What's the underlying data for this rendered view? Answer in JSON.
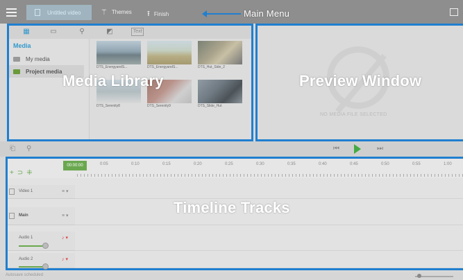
{
  "menubar": {
    "project_title": "Untitled video",
    "themes_label": "Themes",
    "finish_label": "Finish",
    "annotation": "Main Menu"
  },
  "media_library": {
    "tab_text": "Text",
    "section_title": "Media",
    "items": [
      {
        "label": "My media"
      },
      {
        "label": "Project media"
      }
    ],
    "thumbnails": [
      {
        "label": "DTS_EnergyandS..."
      },
      {
        "label": "DTS_EnergyandS..."
      },
      {
        "label": "DTS_Hut_Side_2"
      },
      {
        "label": "DTS_Serenity8"
      },
      {
        "label": "DTS_Serenity9"
      },
      {
        "label": "DTS_Slide_Hut"
      }
    ],
    "annotation": "Media Library"
  },
  "preview": {
    "message": "NO MEDIA FILE SELECTED",
    "annotation": "Preview Window"
  },
  "timeline": {
    "playhead": "00:00:00",
    "ticks": [
      "0:05",
      "0:10",
      "0:15",
      "0:20",
      "0:25",
      "0:30",
      "0:35",
      "0:40",
      "0:45",
      "0:50",
      "0:55",
      "1:00"
    ],
    "tracks": [
      {
        "name": "Video 1"
      },
      {
        "name": "Main"
      },
      {
        "name": "Audio 1"
      },
      {
        "name": "Audio 2"
      }
    ],
    "annotation": "Timeline Tracks"
  },
  "status": {
    "text": "Autosave scheduled"
  },
  "colors": {
    "highlight": "#1f7fd0",
    "accent_green": "#6aa84f"
  }
}
